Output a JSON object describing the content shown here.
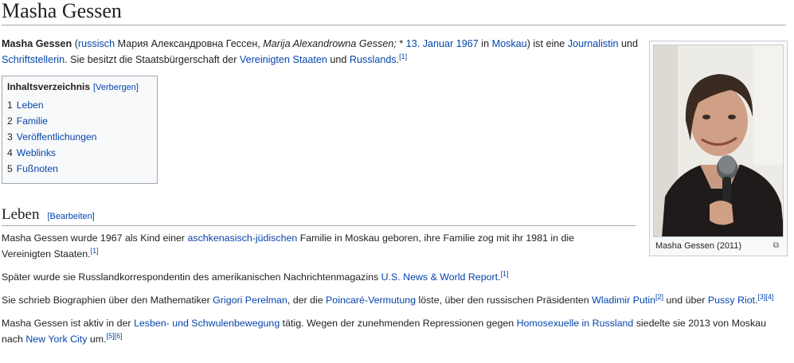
{
  "page": {
    "title": "Masha Gessen"
  },
  "intro": {
    "name": "Masha Gessen",
    "paren_open": " (",
    "lang_link": "russisch",
    "cyrillic": " Мария Александровна Гессен, ",
    "translit": "Marija Alexandrowna Gessen;",
    "born": " * ",
    "date_link": "13. Januar 1967",
    "in": " in ",
    "city_link": "Moskau",
    "tail1": ") ist eine ",
    "job1_link": "Journalistin",
    "und1": " und ",
    "job2_link": "Schriftstellerin",
    "tail2": ". Sie besitzt die Staatsbürgerschaft der ",
    "country1_link": "Vereinigten Staaten",
    "und2": " und ",
    "country2_link": "Russlands",
    "end": ".",
    "ref": "[1]"
  },
  "toc": {
    "heading": "Inhaltsverzeichnis",
    "toggle": "[Verbergen]",
    "items": [
      {
        "num": "1",
        "label": "Leben"
      },
      {
        "num": "2",
        "label": "Familie"
      },
      {
        "num": "3",
        "label": "Veröffentlichungen"
      },
      {
        "num": "4",
        "label": "Weblinks"
      },
      {
        "num": "5",
        "label": "Fußnoten"
      }
    ]
  },
  "thumb": {
    "caption": "Masha Gessen (2011)",
    "magnify_icon": "magnify-icon"
  },
  "section": {
    "heading": "Leben",
    "edit": "[Bearbeiten]"
  },
  "paragraphs": {
    "p1": {
      "t1": "Masha Gessen wurde 1967 als Kind einer ",
      "link1": "aschkenasisch-jüdischen",
      "t2": " Familie in Moskau geboren, ihre Familie zog mit ihr 1981 in die Vereinigten Staaten.",
      "ref": "[1]"
    },
    "p2": {
      "t1": "Später wurde sie Russlandkorrespondentin des amerikanischen Nachrichtenmagazins ",
      "link1": "U.S. News & World Report",
      "t2": ".",
      "ref": "[1]"
    },
    "p3": {
      "t1": "Sie schrieb Biographien über den Mathematiker ",
      "link1": "Grigori Perelman",
      "t2": ", der die ",
      "link2": "Poincaré-Vermutung",
      "t3": " löste, über den russischen Präsidenten ",
      "link3": "Wladimir Putin",
      "ref1": "[2]",
      "t4": " und über ",
      "link4": "Pussy Riot",
      "t5": ".",
      "ref2": "[3][4]"
    },
    "p4": {
      "t1": "Masha Gessen ist aktiv in der ",
      "link1": "Lesben- und Schwulenbewegung",
      "t2": " tätig. Wegen der zunehmenden Repressionen gegen ",
      "link2": "Homosexuelle in Russland",
      "t3": " siedelte sie 2013 von Moskau nach ",
      "link3": "New York City",
      "t4": " um.",
      "ref": "[5][6]"
    }
  },
  "colors": {
    "link": "#0645ad",
    "text": "#222222",
    "border": "#a2a9b1",
    "toc_bg": "#f8f9fa"
  }
}
